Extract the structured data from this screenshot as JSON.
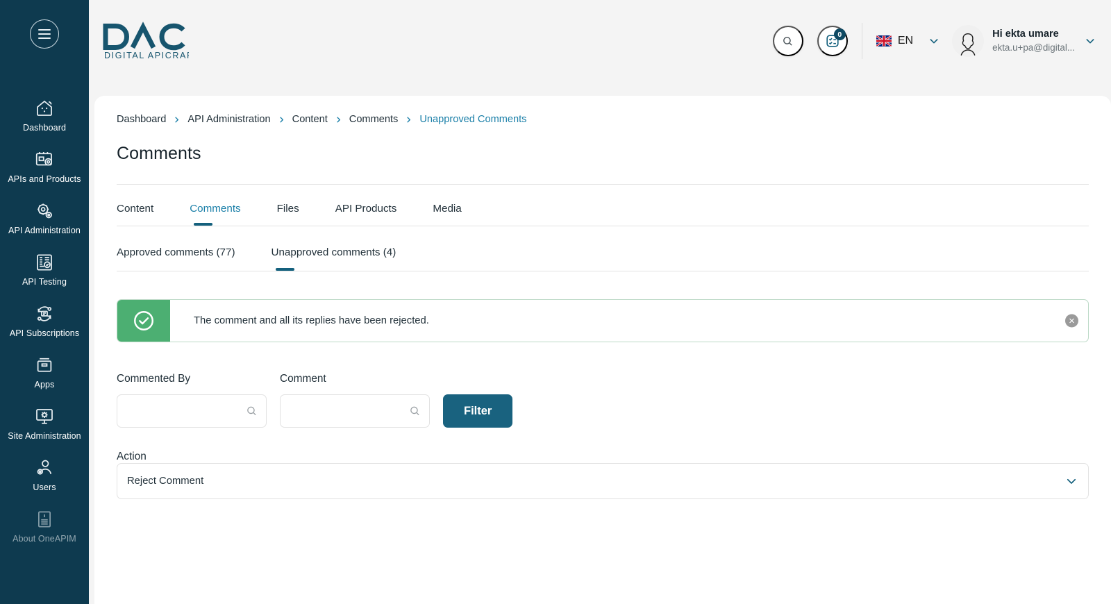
{
  "colors": {
    "sidebar_bg": "#0e3a4f",
    "accent": "#14607d",
    "link": "#1a7fa8",
    "success": "#4caf72",
    "page_bg": "#f4f4f4"
  },
  "sidebar": {
    "toggle_label": "menu-toggle",
    "items": [
      {
        "label": "Dashboard",
        "icon": "dashboard-icon"
      },
      {
        "label": "APIs and Products",
        "icon": "apis-products-icon"
      },
      {
        "label": "API Administration",
        "icon": "api-administration-icon"
      },
      {
        "label": "API Testing",
        "icon": "api-testing-icon"
      },
      {
        "label": "API Subscriptions",
        "icon": "api-subscriptions-icon"
      },
      {
        "label": "Apps",
        "icon": "apps-icon"
      },
      {
        "label": "Site Administration",
        "icon": "site-administration-icon"
      },
      {
        "label": "Users",
        "icon": "users-icon"
      },
      {
        "label": "About OneAPIM",
        "icon": "about-icon"
      }
    ]
  },
  "header": {
    "logo_title": "DAC",
    "logo_subtitle": "DIGITAL APICRAFT",
    "search_icon": "search-icon",
    "tasks_icon": "tasks-icon",
    "tasks_badge": "0",
    "language": "EN",
    "language_flag": "uk-flag-icon",
    "user_greeting": "Hi ekta umare",
    "user_email": "ekta.u+pa@digital..."
  },
  "breadcrumb": [
    {
      "label": "Dashboard",
      "current": false
    },
    {
      "label": "API Administration",
      "current": false
    },
    {
      "label": "Content",
      "current": false
    },
    {
      "label": "Comments",
      "current": false
    },
    {
      "label": "Unapproved Comments",
      "current": true
    }
  ],
  "page": {
    "title": "Comments"
  },
  "tabs": [
    {
      "label": "Content",
      "active": false
    },
    {
      "label": "Comments",
      "active": true
    },
    {
      "label": "Files",
      "active": false
    },
    {
      "label": "API Products",
      "active": false
    },
    {
      "label": "Media",
      "active": false
    }
  ],
  "subtabs": [
    {
      "label": "Approved comments (77)",
      "active": false
    },
    {
      "label": "Unapproved comments (4)",
      "active": true
    }
  ],
  "alert": {
    "message": "The comment and all its replies have been rejected.",
    "icon": "check-circle-icon",
    "close_icon": "close-icon"
  },
  "filters": {
    "commented_by": {
      "label": "Commented By",
      "value": "",
      "placeholder": "",
      "icon": "search-icon"
    },
    "comment": {
      "label": "Comment",
      "value": "",
      "placeholder": "",
      "icon": "search-icon"
    },
    "filter_button": "Filter"
  },
  "action": {
    "label": "Action",
    "selected": "Reject Comment",
    "chevron_icon": "chevron-down-icon"
  }
}
